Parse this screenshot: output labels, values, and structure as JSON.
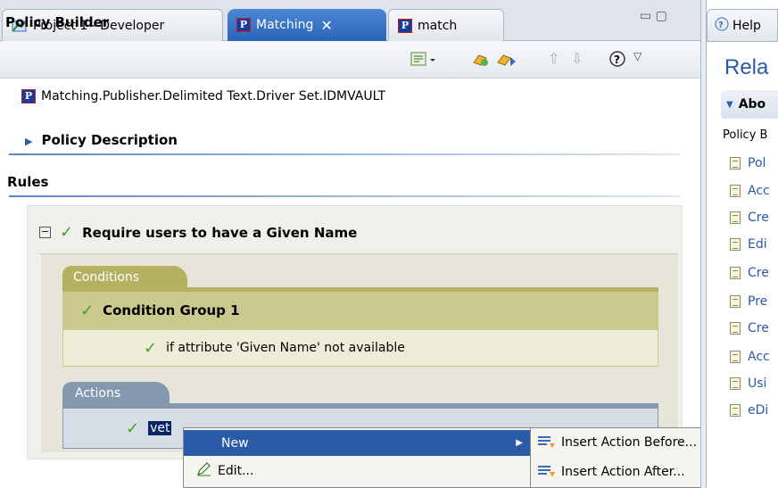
{
  "tabs": [
    {
      "label": "Project 1 - Developer",
      "active": false
    },
    {
      "label": "Matching",
      "active": true
    },
    {
      "label": "match",
      "active": false
    }
  ],
  "close_glyph": "✕",
  "window_controls": "▭ ▢",
  "help_tab": {
    "label": "Help"
  },
  "policy_builder": {
    "title": "Policy Builder",
    "driver_path": "Matching.Publisher.Delimited Text.Driver Set.IDMVAULT",
    "policy_description": "Policy Description",
    "rules_label": "Rules",
    "rule": {
      "title": "Require users to have a Given Name",
      "conditions_tab": "Conditions",
      "condition_group": "Condition Group 1",
      "condition": "if attribute 'Given Name' not available",
      "actions_tab": "Actions",
      "action_selected": "veto()",
      "action_selected_visible": "vet"
    }
  },
  "context_menu": {
    "items": [
      {
        "label": "New",
        "has_submenu": true,
        "highlighted": true
      },
      {
        "label": "Edit...",
        "has_submenu": false,
        "highlighted": false
      }
    ]
  },
  "submenu": {
    "items": [
      {
        "label": "Insert Action Before..."
      },
      {
        "label": "Insert Action After..."
      }
    ]
  },
  "right_panel": {
    "heading": "Rela",
    "section": "Abo",
    "section_text": "Policy B",
    "links": [
      "Pol",
      "Acc",
      "Cre",
      "Edi",
      "Cre",
      "Pre",
      "Cre",
      "Acc",
      "Usi",
      "eDi"
    ]
  },
  "colors": {
    "accent": "#2a5aa8",
    "conditions": "#b4b162",
    "actions": "#8499ad",
    "check": "#43a02a"
  }
}
